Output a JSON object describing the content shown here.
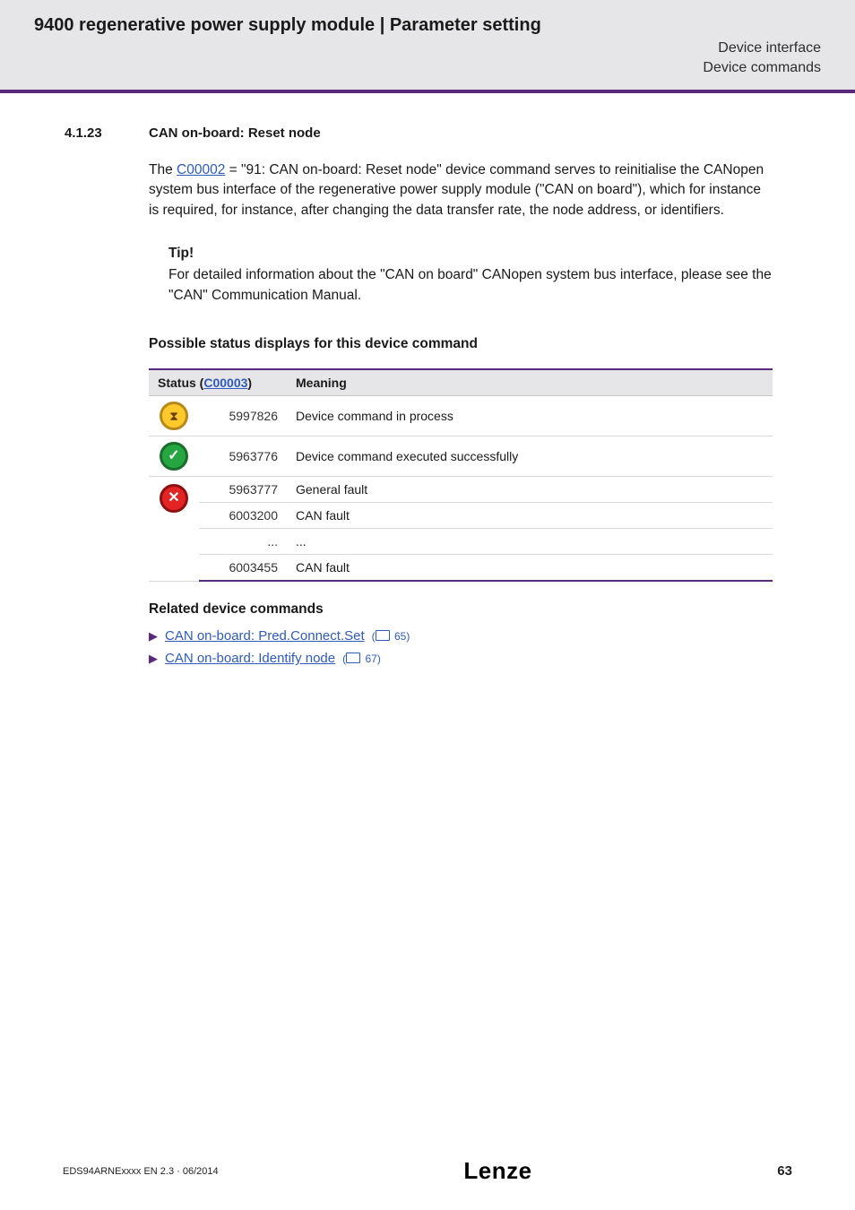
{
  "band": {
    "title": "9400 regenerative power supply module | Parameter setting",
    "sub1": "Device interface",
    "sub2": "Device commands"
  },
  "section": {
    "num": "4.1.23",
    "title": "CAN on-board: Reset node"
  },
  "para": {
    "pre": "The ",
    "code_link": "C00002",
    "post_a": " = \"91: CAN on-board: Reset node\" device command serves to reinitialise the CANopen system bus interface of the regenerative power supply module (\"CAN on board\"), which for instance is required, for instance, after changing the data transfer rate, the node address, or identifiers."
  },
  "tip": {
    "head": "Tip!",
    "text": "For detailed information about the \"CAN on board\" CANopen system bus interface, please see the \"CAN\" Communication Manual."
  },
  "status_head": "Possible status displays for this device command",
  "table": {
    "h_status_pre": "Status (",
    "h_status_link": "C00003",
    "h_status_post": ")",
    "h_meaning": "Meaning",
    "rows": [
      {
        "icon": "yellow",
        "code": "5997826",
        "meaning": "Device command in process"
      },
      {
        "icon": "green",
        "code": "5963776",
        "meaning": "Device command executed successfully"
      },
      {
        "icon": "red",
        "code": "5963777",
        "meaning": "General fault"
      },
      {
        "icon": "",
        "code": "6003200",
        "meaning": "CAN fault"
      },
      {
        "icon": "",
        "code": "...",
        "meaning": "..."
      },
      {
        "icon": "",
        "code": "6003455",
        "meaning": "CAN fault"
      }
    ]
  },
  "related": {
    "head": "Related device commands",
    "items": [
      {
        "label": "CAN on-board: Pred.Connect.Set",
        "page": "65"
      },
      {
        "label": "CAN on-board: Identify node",
        "page": "67"
      }
    ]
  },
  "footer": {
    "left": "EDS94ARNExxxx EN 2.3 · 06/2014",
    "logo": "Lenze",
    "right": "63"
  }
}
